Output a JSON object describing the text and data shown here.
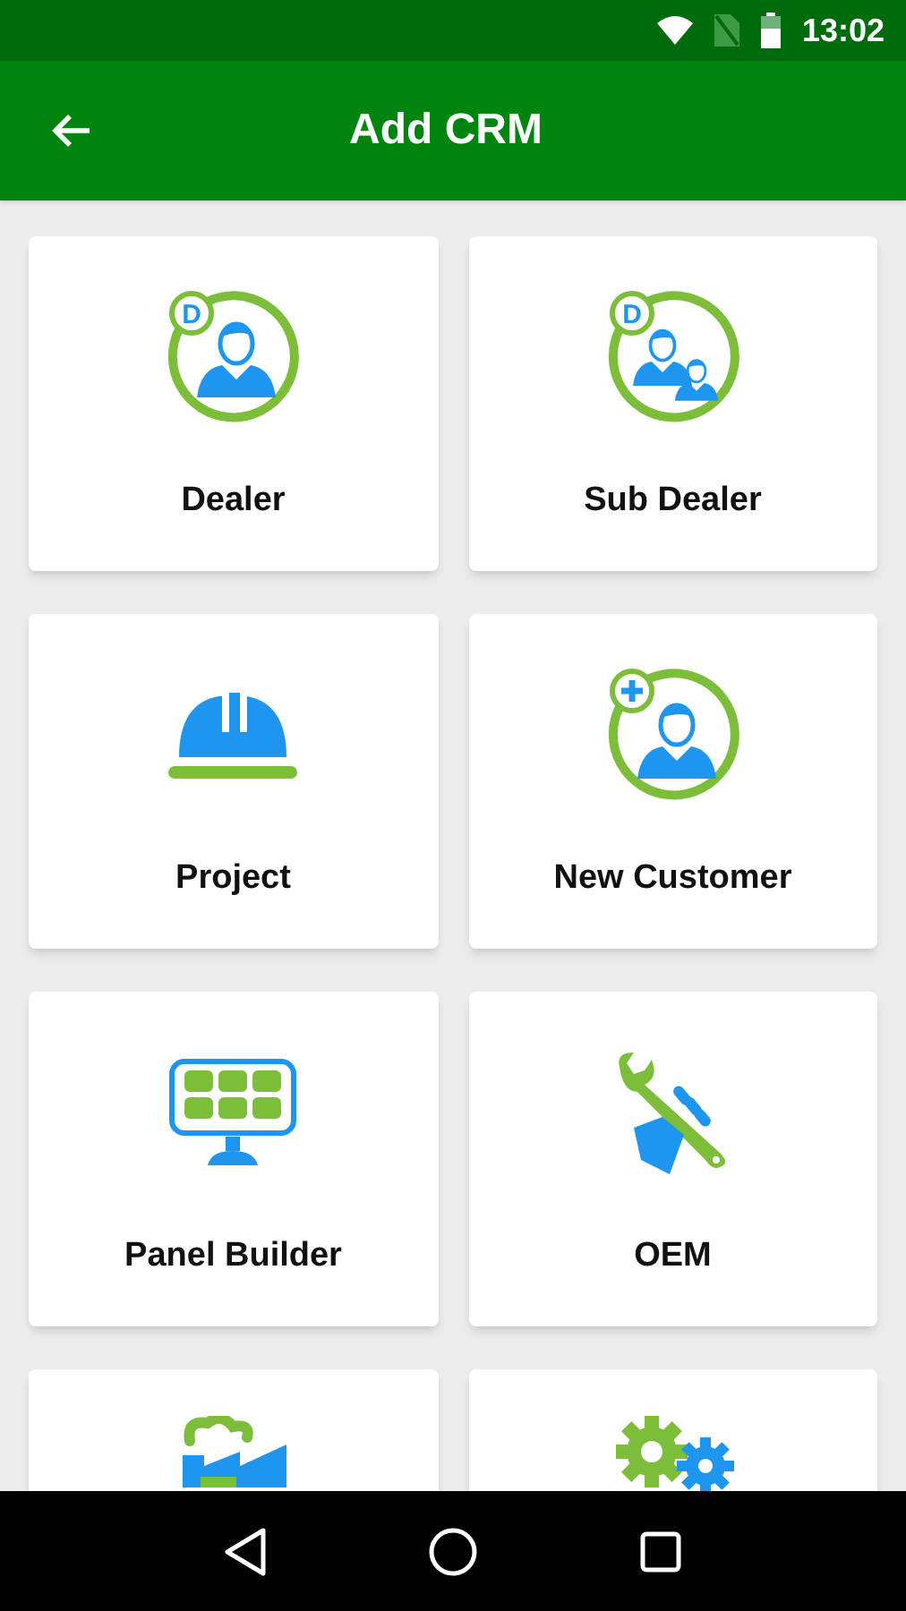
{
  "status_bar": {
    "time": "13:02"
  },
  "app_bar": {
    "title": "Add CRM"
  },
  "tiles": [
    {
      "kind": "dealer",
      "badge": "D",
      "label": "Dealer"
    },
    {
      "kind": "subdealer",
      "badge": "D",
      "label": "Sub Dealer"
    },
    {
      "kind": "project",
      "label": "Project"
    },
    {
      "kind": "customer",
      "label": "New Customer"
    },
    {
      "kind": "panel",
      "label": "Panel Builder"
    },
    {
      "kind": "oem",
      "label": "OEM"
    },
    {
      "kind": "factory"
    },
    {
      "kind": "gears"
    }
  ]
}
